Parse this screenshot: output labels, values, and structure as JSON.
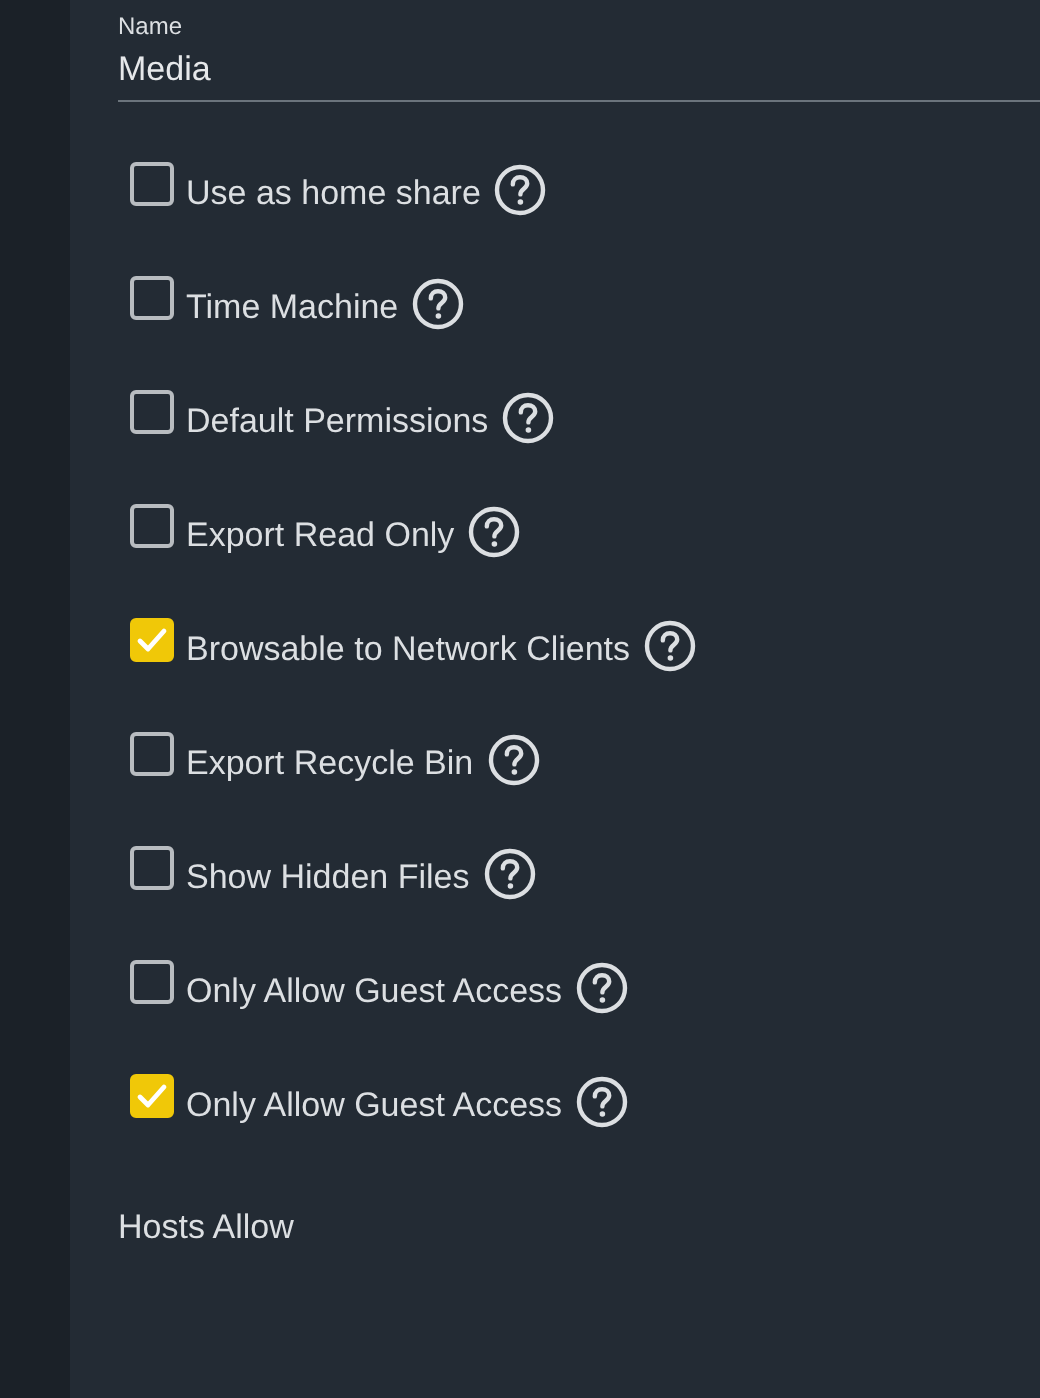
{
  "name_field": {
    "label": "Name",
    "value": "Media"
  },
  "options": [
    {
      "label": "Use as home share",
      "checked": false
    },
    {
      "label": "Time Machine",
      "checked": false
    },
    {
      "label": "Default Permissions",
      "checked": false
    },
    {
      "label": "Export Read Only",
      "checked": false
    },
    {
      "label": "Browsable to Network Clients",
      "checked": true
    },
    {
      "label": "Export Recycle Bin",
      "checked": false
    },
    {
      "label": "Show Hidden Files",
      "checked": false
    },
    {
      "label": "Only Allow Guest Access",
      "checked": false
    },
    {
      "label": "Only Allow Guest Access",
      "checked": true
    }
  ],
  "hosts_allow": {
    "label": "Hosts Allow"
  }
}
